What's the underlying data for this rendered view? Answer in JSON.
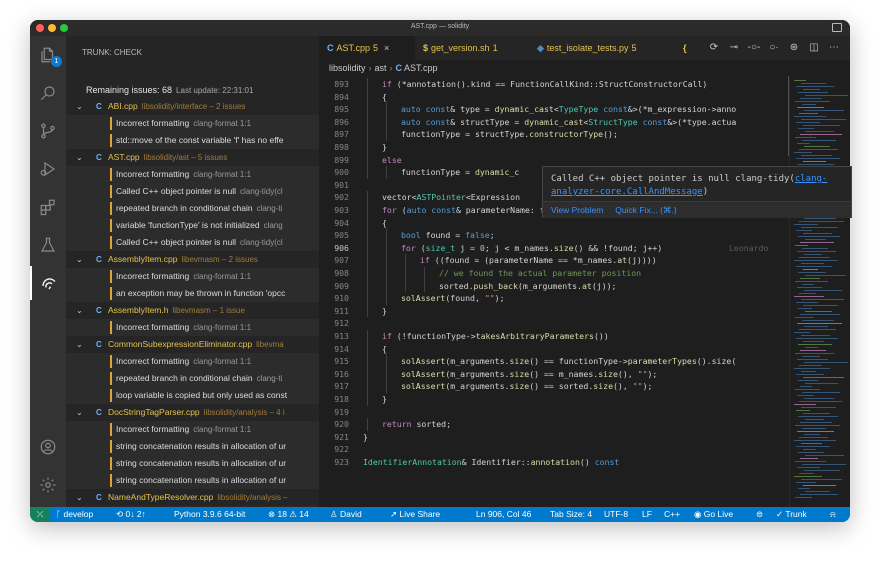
{
  "window": {
    "title": "AST.cpp — solidity"
  },
  "activity_bar": {
    "explorer_badge": "1"
  },
  "sidebar": {
    "title": "TRUNK: CHECK",
    "remaining_label": "Remaining issues: 68",
    "last_update": "Last update: 22:31:01",
    "rows": [
      {
        "kind": "file",
        "icon": "C",
        "name": "ABI.cpp",
        "path": "libsolidity/interface – 2 issues"
      },
      {
        "kind": "issue",
        "text": "Incorrect formatting",
        "src": "clang-format 1:1"
      },
      {
        "kind": "issue",
        "text": "std::move of the const variable 'f' has no effe",
        "src": ""
      },
      {
        "kind": "file",
        "icon": "C",
        "name": "AST.cpp",
        "path": "libsolidity/ast – 5 issues"
      },
      {
        "kind": "issue",
        "text": "Incorrect formatting",
        "src": "clang-format 1:1"
      },
      {
        "kind": "issue",
        "text": "Called C++ object pointer is null",
        "src": "clang-tidy(cl"
      },
      {
        "kind": "issue",
        "text": "repeated branch in conditional chain",
        "src": "clang-ti"
      },
      {
        "kind": "issue",
        "text": "variable 'functionType' is not initialized",
        "src": "clang"
      },
      {
        "kind": "issue",
        "text": "Called C++ object pointer is null",
        "src": "clang-tidy(cl"
      },
      {
        "kind": "file",
        "icon": "C",
        "name": "AssemblyItem.cpp",
        "path": "libevmasm – 2 issues"
      },
      {
        "kind": "issue",
        "text": "Incorrect formatting",
        "src": "clang-format 1:1"
      },
      {
        "kind": "issue",
        "text": "an exception may be thrown in function 'opcc",
        "src": ""
      },
      {
        "kind": "file",
        "icon": "C",
        "name": "AssemblyItem.h",
        "path": "libevmasm – 1 issue"
      },
      {
        "kind": "issue",
        "text": "Incorrect formatting",
        "src": "clang-format 1:1"
      },
      {
        "kind": "file",
        "icon": "C",
        "name": "CommonSubexpressionEliminator.cpp",
        "path": "libevma"
      },
      {
        "kind": "issue",
        "text": "Incorrect formatting",
        "src": "clang-format 1:1"
      },
      {
        "kind": "issue",
        "text": "repeated branch in conditional chain",
        "src": "clang-ti"
      },
      {
        "kind": "issue",
        "text": "loop variable is copied but only used as const",
        "src": ""
      },
      {
        "kind": "file",
        "icon": "C",
        "name": "DocStringTagParser.cpp",
        "path": "libsolidity/analysis – 4 i"
      },
      {
        "kind": "issue",
        "text": "Incorrect formatting",
        "src": "clang-format 1:1"
      },
      {
        "kind": "issue",
        "text": "string concatenation results in allocation of ur",
        "src": ""
      },
      {
        "kind": "issue",
        "text": "string concatenation results in allocation of ur",
        "src": ""
      },
      {
        "kind": "issue",
        "text": "string concatenation results in allocation of ur",
        "src": ""
      },
      {
        "kind": "file",
        "icon": "C",
        "name": "NameAndTypeResolver.cpp",
        "path": "libsolidity/analysis –"
      },
      {
        "kind": "issue",
        "text": "Incorrect formatting",
        "src": "clang-format 1:1"
      }
    ]
  },
  "tabs": [
    {
      "icon": "C",
      "label": "AST.cpp",
      "count": "5",
      "close": "×",
      "active": true,
      "color": "#6fb3f2"
    },
    {
      "icon": "$",
      "label": "get_version.sh",
      "count": "1",
      "active": false,
      "color": "#e7c24a"
    },
    {
      "icon": "◆",
      "label": "test_isolate_tests.py",
      "count": "5",
      "active": false,
      "color": "#e7c24a"
    },
    {
      "icon": "{",
      "label": "",
      "count": "",
      "active": false,
      "color": "#e7c24a"
    }
  ],
  "breadcrumb": {
    "root": "libsolidity",
    "folder": "ast",
    "file": "AST.cpp"
  },
  "editor": {
    "current_line": "906",
    "blame": "Leonardo",
    "lines": [
      {
        "n": "893",
        "indent": 1,
        "html": "<span class='c'>if</span> (*annotation().kind == FunctionCallKind::StructConstructorCall)"
      },
      {
        "n": "894",
        "indent": 1,
        "html": "{"
      },
      {
        "n": "895",
        "indent": 2,
        "html": "<span class='k'>auto const</span>&amp; type = <span class='f'>dynamic_cast</span>&lt;<span class='t'>TypeType</span> <span class='k'>const</span>&amp;&gt;(*m_expression-&gt;anno"
      },
      {
        "n": "896",
        "indent": 2,
        "html": "<span class='k'>auto const</span>&amp; structType = <span class='f'>dynamic_cast</span>&lt;<span class='t'>StructType</span> <span class='k'>const</span>&amp;&gt;(*type.actua"
      },
      {
        "n": "897",
        "indent": 2,
        "html": "functionType = structType.<span class='f'>constructorType</span>();"
      },
      {
        "n": "898",
        "indent": 1,
        "html": "}"
      },
      {
        "n": "899",
        "indent": 1,
        "html": "<span class='c'>else</span>"
      },
      {
        "n": "900",
        "indent": 2,
        "html": "functionType = <span class='f'>dynamic_c</span>"
      },
      {
        "n": "901",
        "indent": 0,
        "html": ""
      },
      {
        "n": "902",
        "indent": 1,
        "html": "vector&lt;<span class='t'>ASTPointer</span>&lt;Expression"
      },
      {
        "n": "903",
        "indent": 1,
        "html": "<span class='c'>for</span> (<span class='k'>auto const</span>&amp; parameterName: functionType-&gt;<span class='f'>parameterNames</span>())"
      },
      {
        "n": "904",
        "indent": 1,
        "html": "{"
      },
      {
        "n": "905",
        "indent": 2,
        "html": "<span class='k'>bool</span> found = <span class='k'>false</span>;"
      },
      {
        "n": "906",
        "indent": 2,
        "html": "<span class='c'>for</span> (<span class='t'>size_t</span> j = <span class='n'>0</span>; j &lt; m_names.<span class='f'>size</span>() &amp;&amp; !found; j++)"
      },
      {
        "n": "907",
        "indent": 3,
        "html": "<span class='c'>if</span> ((found = (parameterName == *m_names.<span class='f'>at</span>(j))))"
      },
      {
        "n": "908",
        "indent": 4,
        "html": "<span class='cm'>// we found the actual parameter position</span>"
      },
      {
        "n": "909",
        "indent": 4,
        "html": "sorted.<span class='f'>push_back</span>(m_arguments.<span class='f'>at</span>(j));"
      },
      {
        "n": "910",
        "indent": 2,
        "html": "<span class='f'>solAssert</span>(found, <span class='s'>\"\"</span>);"
      },
      {
        "n": "911",
        "indent": 1,
        "html": "}"
      },
      {
        "n": "912",
        "indent": 0,
        "html": ""
      },
      {
        "n": "913",
        "indent": 1,
        "html": "<span class='c'>if</span> (!functionType-&gt;<span class='f'>takesArbitraryParameters</span>())"
      },
      {
        "n": "914",
        "indent": 1,
        "html": "{"
      },
      {
        "n": "915",
        "indent": 2,
        "html": "<span class='f'>solAssert</span>(m_arguments.<span class='f'>size</span>() == functionType-&gt;<span class='f'>parameterTypes</span>().<span class='f'>size</span>("
      },
      {
        "n": "916",
        "indent": 2,
        "html": "<span class='f'>solAssert</span>(m_arguments.<span class='f'>size</span>() == m_names.<span class='f'>size</span>(), <span class='s'>\"\"</span>);"
      },
      {
        "n": "917",
        "indent": 2,
        "html": "<span class='f'>solAssert</span>(m_arguments.<span class='f'>size</span>() == sorted.<span class='f'>size</span>(), <span class='s'>\"\"</span>);"
      },
      {
        "n": "918",
        "indent": 1,
        "html": "}"
      },
      {
        "n": "919",
        "indent": 0,
        "html": ""
      },
      {
        "n": "920",
        "indent": 1,
        "html": "<span class='c'>return</span> sorted;"
      },
      {
        "n": "921",
        "indent": 0,
        "html": "}"
      },
      {
        "n": "922",
        "indent": 0,
        "html": ""
      },
      {
        "n": "923",
        "indent": 0,
        "html": "<span class='t'>IdentifierAnnotation</span>&amp; Identifier::<span class='f'>annotation</span>() <span class='k'>const</span>"
      }
    ]
  },
  "hover": {
    "message": "Called C++ object pointer is null",
    "source": "clang-tidy(",
    "link": "clang-analyzer-core.CallAndMessage",
    "source_end": ")",
    "action_view": "View Problem",
    "action_fix": "Quick Fix... (⌘.)"
  },
  "status": {
    "branch": "develop",
    "sync": "0↓ 2↑",
    "python": "Python 3.9.6 64-bit",
    "problems": "⊗ 18 ⚠ 14",
    "user": "David",
    "live_share": "Live Share",
    "position": "Ln 906, Col 46",
    "tab_size": "Tab Size: 4",
    "encoding": "UTF-8",
    "eol": "LF",
    "language": "C++",
    "go_live": "Go Live",
    "trunk": "Trunk"
  }
}
